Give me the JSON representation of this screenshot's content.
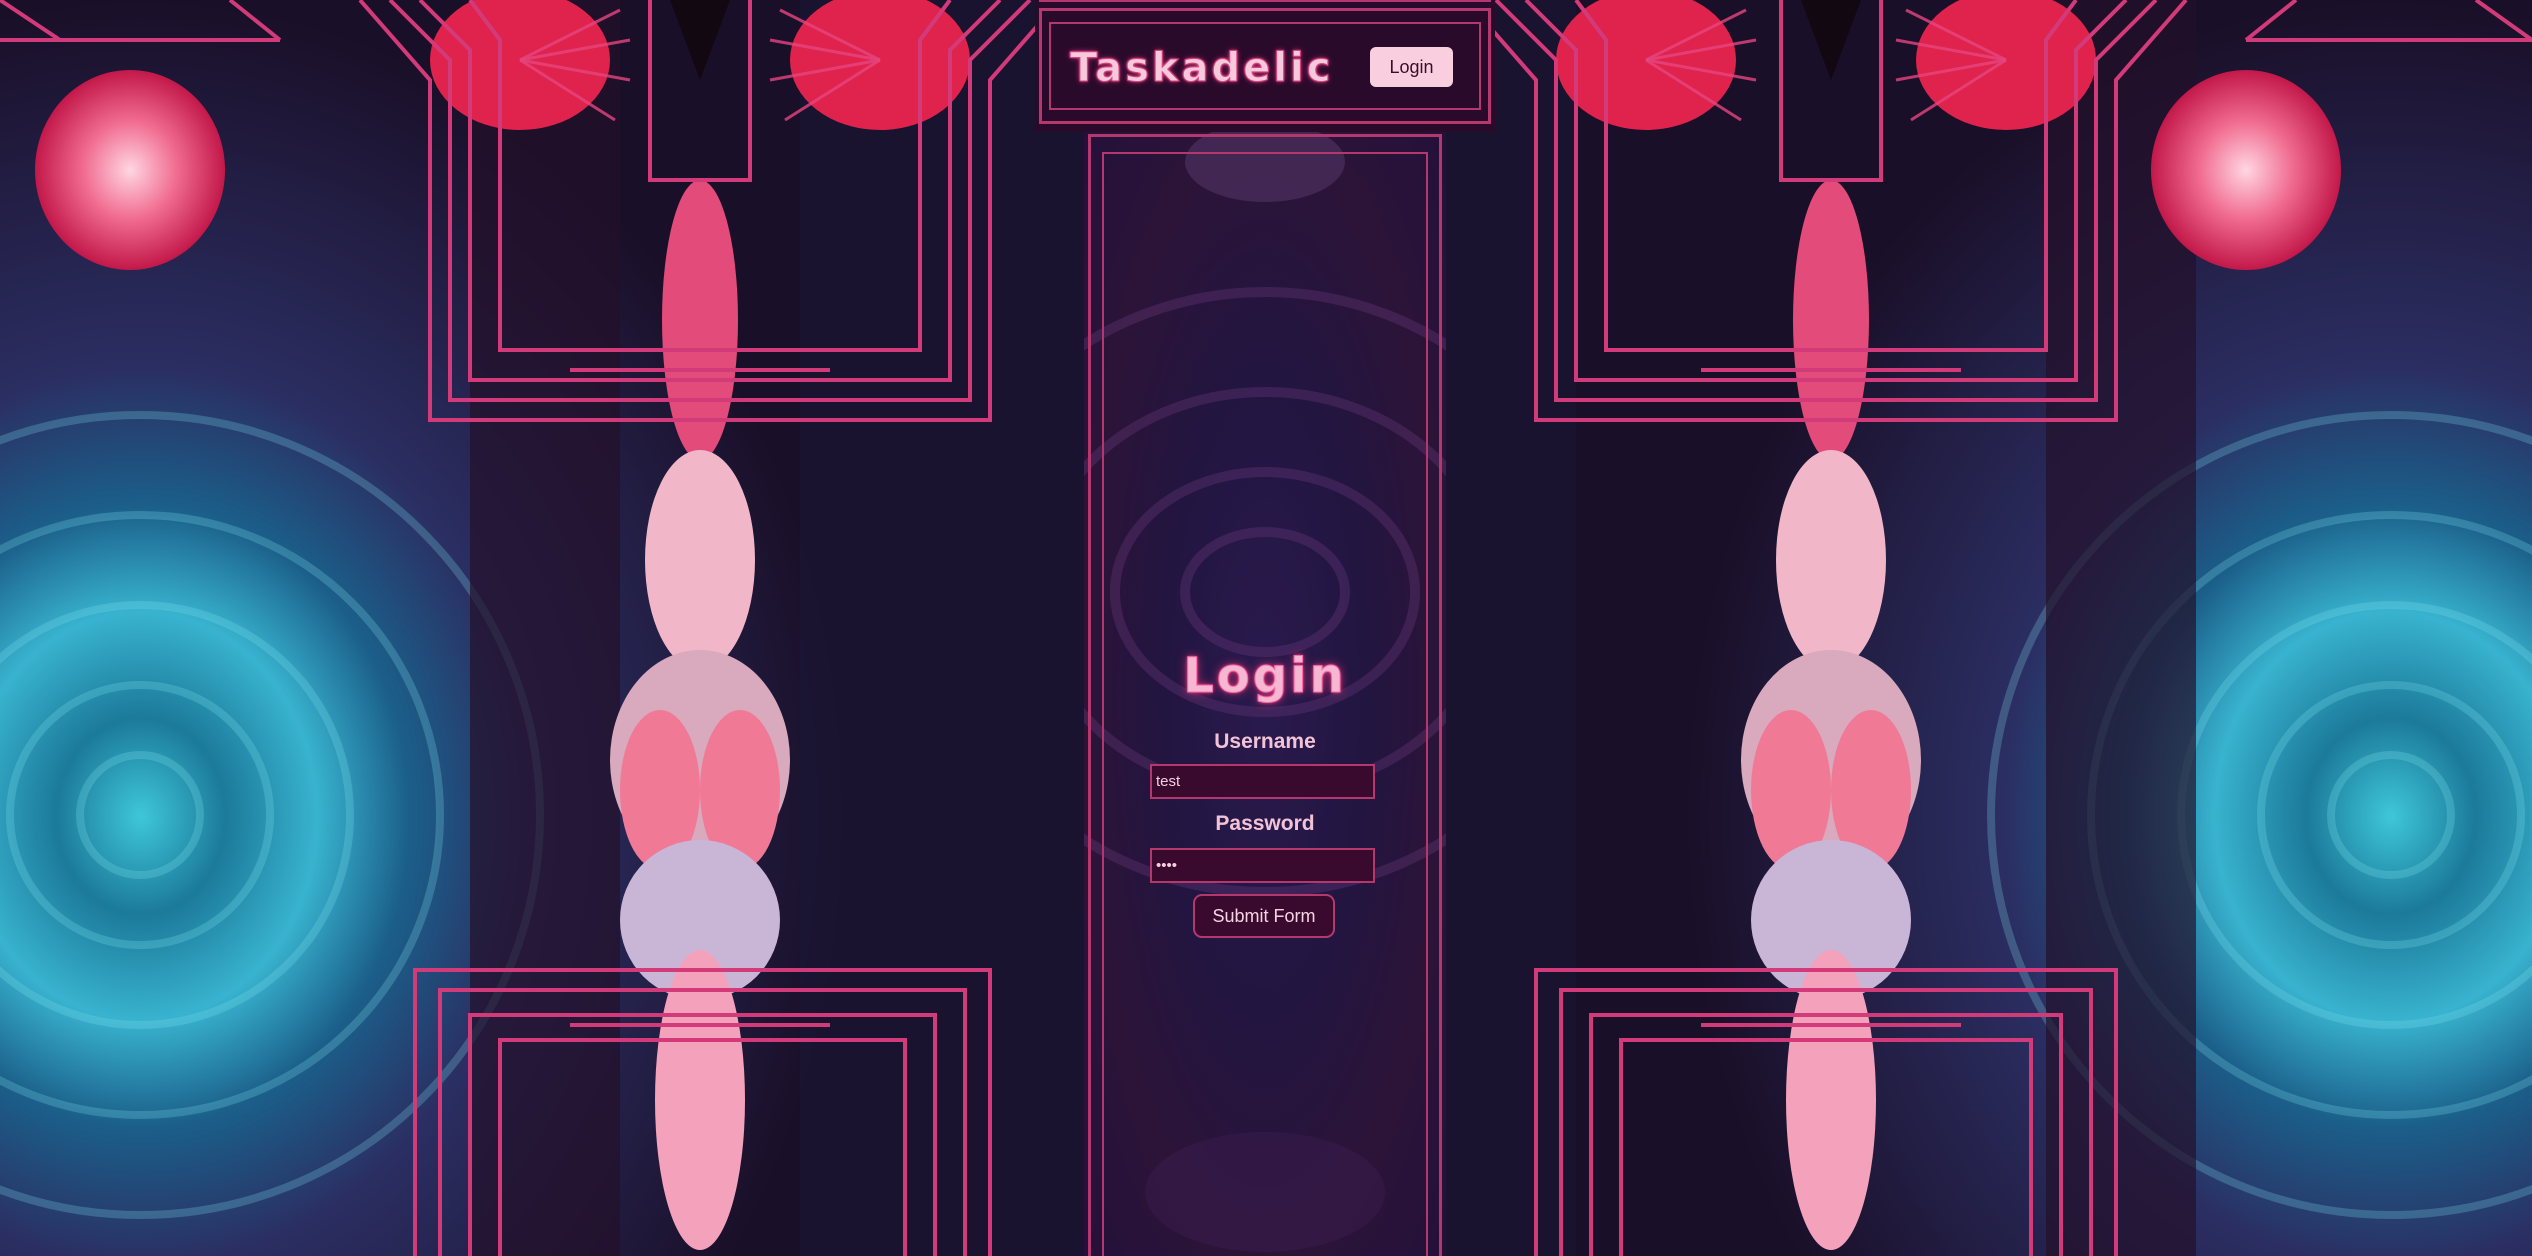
{
  "header": {
    "brand": "Taskadelic",
    "login_button": "Login"
  },
  "login_form": {
    "title": "Login",
    "username_label": "Username",
    "username_value": "test",
    "password_label": "Password",
    "password_value": "test",
    "submit_label": "Submit Form"
  },
  "colors": {
    "accent": "#b4386e",
    "header_bg": "#2a0a2b",
    "column_bg": "#221540",
    "button_bg": "#f9cfe0",
    "input_bg": "#3a0a2e",
    "text_pink": "#f2c3d8"
  }
}
